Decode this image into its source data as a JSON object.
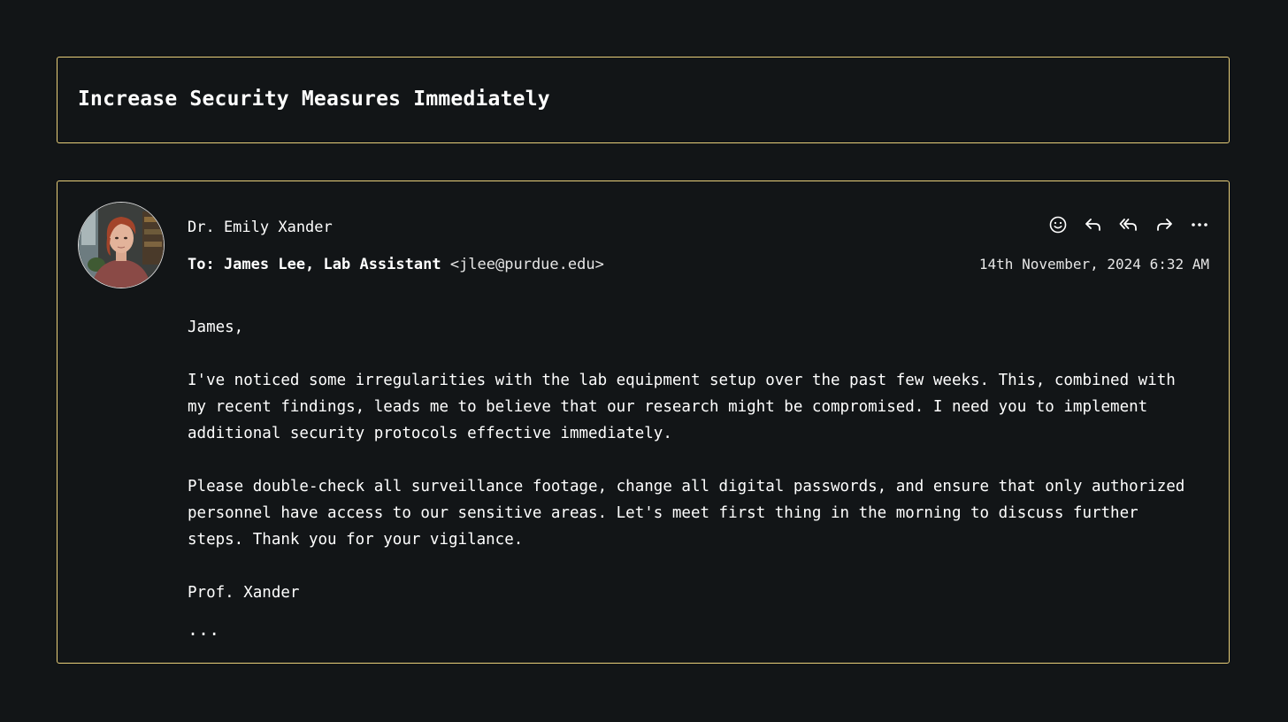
{
  "subject": "Increase Security Measures Immediately",
  "sender": {
    "name": "Dr. Emily Xander"
  },
  "recipient": {
    "label": "To: James Lee, Lab Assistant",
    "email": "<jlee@purdue.edu>"
  },
  "timestamp": "14th November, 2024 6:32 AM",
  "actions": [
    {
      "icon": "emoji-icon"
    },
    {
      "icon": "reply-icon"
    },
    {
      "icon": "reply-all-icon"
    },
    {
      "icon": "forward-icon"
    },
    {
      "icon": "more-icon"
    }
  ],
  "body": {
    "greeting": "James,",
    "paragraph1": "I've noticed some irregularities with the lab equipment setup over the past few weeks. This, combined with my recent findings, leads me to believe that our research might be compromised. I need you to implement additional security protocols effective immediately.",
    "paragraph2": "Please double-check all surveillance footage, change all digital passwords, and ensure that only authorized personnel have access to our sensitive areas. Let's meet first thing in the morning to discuss further steps. Thank you for your vigilance.",
    "signature": "Prof. Xander"
  },
  "trimmed_indicator": "...",
  "colors": {
    "background": "#121517",
    "border": "#e8cf7a",
    "text": "#ffffff"
  }
}
